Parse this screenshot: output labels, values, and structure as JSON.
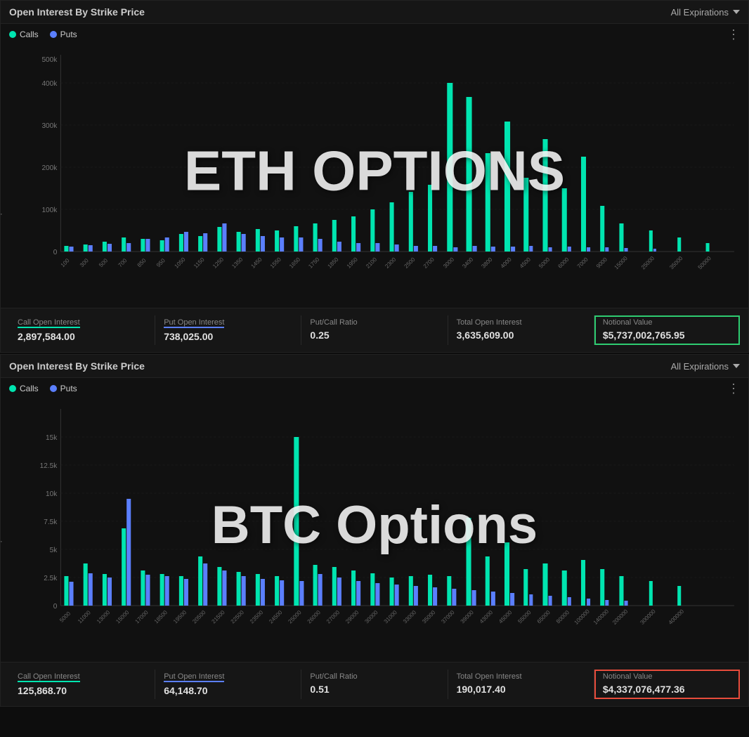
{
  "eth_panel": {
    "title": "Open Interest By Strike Price",
    "expiry": "All Expirations",
    "watermark": "ETH OPTIONS",
    "legend": {
      "calls_label": "Calls",
      "puts_label": "Puts"
    },
    "y_axis_label": "Open Interest",
    "x_labels": [
      "100",
      "300",
      "500",
      "700",
      "850",
      "950",
      "1050",
      "1150",
      "1250",
      "1350",
      "1450",
      "1550",
      "1650",
      "1750",
      "1850",
      "1950",
      "2100",
      "2300",
      "2500",
      "2700",
      "3000",
      "3400",
      "3800",
      "4000",
      "4500",
      "5000",
      "6000",
      "7000",
      "9000",
      "15000",
      "25000",
      "35000",
      "50000"
    ],
    "y_labels": [
      "0",
      "100k",
      "200k",
      "300k",
      "400k",
      "500k"
    ],
    "stats": {
      "call_oi_label": "Call Open Interest",
      "call_oi_value": "2,897,584.00",
      "put_oi_label": "Put Open Interest",
      "put_oi_value": "738,025.00",
      "put_call_label": "Put/Call Ratio",
      "put_call_value": "0.25",
      "total_oi_label": "Total Open Interest",
      "total_oi_value": "3,635,609.00",
      "notional_label": "Notional Value",
      "notional_value": "$5,737,002,765.95",
      "notional_highlight": "green"
    }
  },
  "btc_panel": {
    "title": "Open Interest By Strike Price",
    "expiry": "All Expirations",
    "watermark": "BTC Options",
    "legend": {
      "calls_label": "Calls",
      "puts_label": "Puts"
    },
    "y_axis_label": "Open Interest",
    "x_labels": [
      "5000",
      "11000",
      "13000",
      "15000",
      "17000",
      "18500",
      "19500",
      "20500",
      "21500",
      "22500",
      "23500",
      "24500",
      "25000",
      "26000",
      "27000",
      "29000",
      "30000",
      "31000",
      "33000",
      "35000",
      "37000",
      "39000",
      "43000",
      "45000",
      "55000",
      "65000",
      "80000",
      "100000",
      "140000",
      "200000",
      "300000",
      "400000"
    ],
    "y_labels": [
      "0",
      "2.5k",
      "5k",
      "7.5k",
      "10k",
      "12.5k",
      "15k"
    ],
    "stats": {
      "call_oi_label": "Call Open Interest",
      "call_oi_value": "125,868.70",
      "put_oi_label": "Put Open Interest",
      "put_oi_value": "64,148.70",
      "put_call_label": "Put/Call Ratio",
      "put_call_value": "0.51",
      "total_oi_label": "Total Open Interest",
      "total_oi_value": "190,017.40",
      "notional_label": "Notional Value",
      "notional_value": "$4,337,076,477.36",
      "notional_highlight": "red"
    }
  }
}
